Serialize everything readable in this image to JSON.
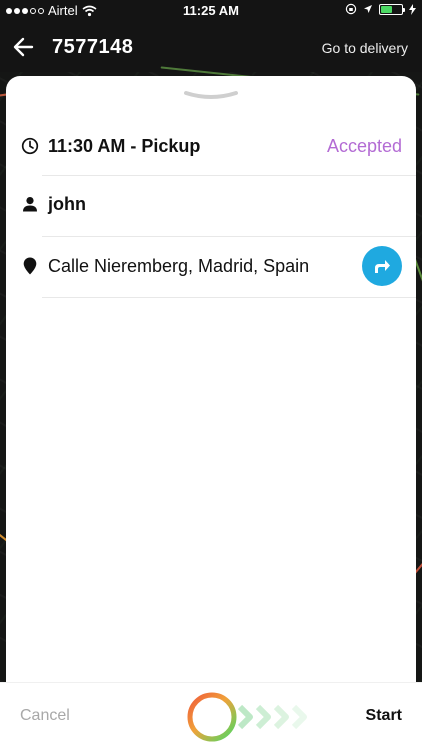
{
  "status_bar": {
    "carrier": "Airtel",
    "time": "11:25 AM",
    "battery_level": 0.55
  },
  "nav": {
    "order_number": "7577148",
    "action_label": "Go to delivery"
  },
  "pickup": {
    "time_label": "11:30 AM - Pickup",
    "status": "Accepted",
    "status_color": "#b36bd4"
  },
  "customer": {
    "name": "john"
  },
  "location": {
    "address": "Calle Nieremberg, Madrid, Spain",
    "direction_button_color": "#1fa9e0"
  },
  "footer": {
    "cancel_label": "Cancel",
    "start_label": "Start"
  },
  "icons": {
    "back": "arrow-left-icon",
    "clock": "clock-icon",
    "person": "person-icon",
    "pin": "location-pin-icon",
    "directions": "turn-right-arrow-icon"
  }
}
